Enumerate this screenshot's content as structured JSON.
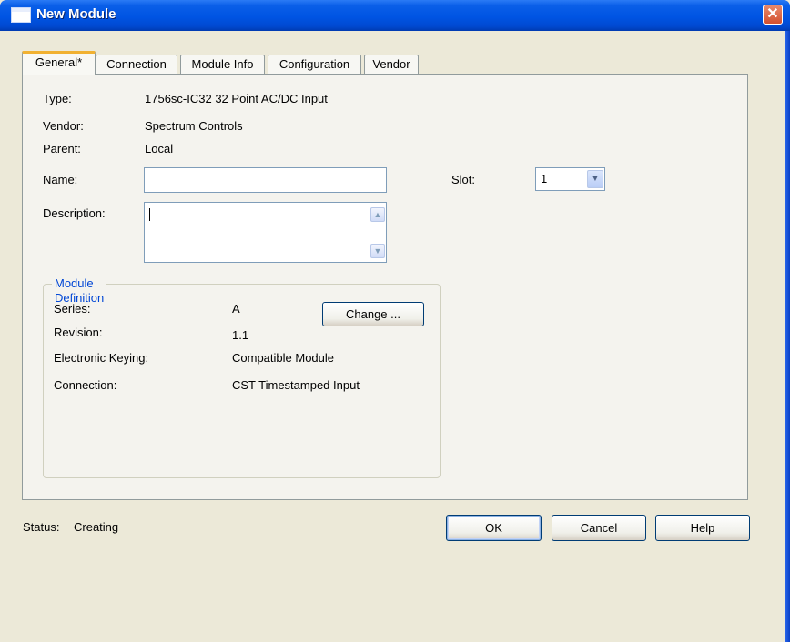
{
  "window": {
    "title": "New Module",
    "close_glyph": "✕"
  },
  "tabs": [
    {
      "label": "General*",
      "active": true
    },
    {
      "label": "Connection",
      "active": false
    },
    {
      "label": "Module Info",
      "active": false
    },
    {
      "label": "Configuration",
      "active": false
    },
    {
      "label": "Vendor",
      "active": false
    }
  ],
  "general": {
    "type_label": "Type:",
    "type_value": "1756sc-IC32 32 Point AC/DC Input",
    "vendor_label": "Vendor:",
    "vendor_value": "Spectrum Controls",
    "parent_label": "Parent:",
    "parent_value": "Local",
    "name_label": "Name:",
    "name_value": "",
    "description_label": "Description:",
    "description_value": "",
    "slot_label": "Slot:",
    "slot_value": "1"
  },
  "module_definition": {
    "legend": "Module Definition",
    "series_label": "Series:",
    "series_value": "A",
    "revision_label": "Revision:",
    "revision_value": "1.1",
    "keying_label": "Electronic Keying:",
    "keying_value": "Compatible Module",
    "connection_label": "Connection:",
    "connection_value": "CST Timestamped Input",
    "change_button": "Change ..."
  },
  "footer": {
    "status_label": "Status:",
    "status_value": "Creating",
    "ok_button": "OK",
    "cancel_button": "Cancel",
    "help_button": "Help"
  },
  "icons": {
    "window_icon": "window-icon",
    "close": "close-icon",
    "dropdown": "chevron-down-icon",
    "scroll_up": "scroll-up-icon",
    "scroll_down": "scroll-down-icon"
  },
  "colors": {
    "titlebar": "#0054e3",
    "dialog_bg": "#ece9d8",
    "panel_bg": "#f4f3ee",
    "group_label": "#0046d5",
    "close_button": "#d4502e"
  }
}
